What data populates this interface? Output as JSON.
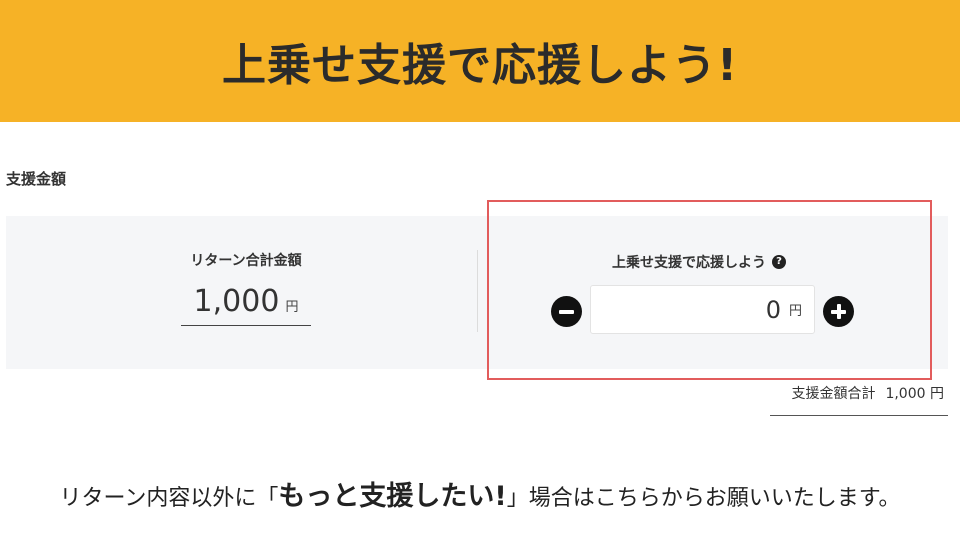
{
  "banner": {
    "title": "上乗せ支援で応援しよう!",
    "color": "#f6b226"
  },
  "section": {
    "label": "支援金額"
  },
  "return_total": {
    "label": "リターン合計金額",
    "amount": "1,000",
    "currency": "円"
  },
  "boost": {
    "label": "上乗せ支援で応援しよう",
    "help_icon": "question-circle-icon",
    "minus_icon": "minus-circle-icon",
    "plus_icon": "plus-circle-icon",
    "value": "0",
    "currency": "円",
    "highlight_color": "#e25c5c"
  },
  "support_total": {
    "label": "支援金額合計",
    "amount": "1,000",
    "currency": "円"
  },
  "message": {
    "prefix": "リターン内容以外に「",
    "emphasis": "もっと支援したい!",
    "suffix": "」場合はこちらからお願いいたします。"
  }
}
